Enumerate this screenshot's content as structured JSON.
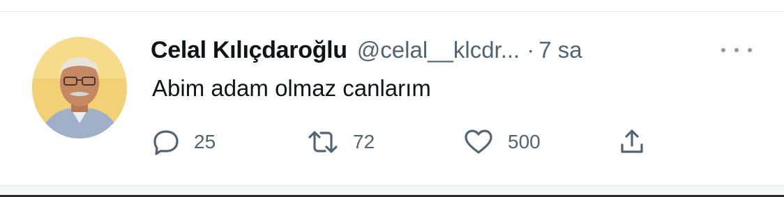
{
  "tweet": {
    "display_name": "Celal Kılıçdaroğlu",
    "handle": "@celal__klcdr...",
    "separator": "·",
    "time": "7 sa",
    "text": "Abim adam olmaz canlarım",
    "avatar_alt": "profile photo",
    "actions": {
      "reply": {
        "icon": "reply-icon",
        "count": "25"
      },
      "retweet": {
        "icon": "retweet-icon",
        "count": "72"
      },
      "like": {
        "icon": "heart-icon",
        "count": "500"
      },
      "share": {
        "icon": "share-icon"
      }
    },
    "colors": {
      "text": "#0f1419",
      "secondary": "#536471",
      "divider": "#e6e9ec"
    }
  }
}
